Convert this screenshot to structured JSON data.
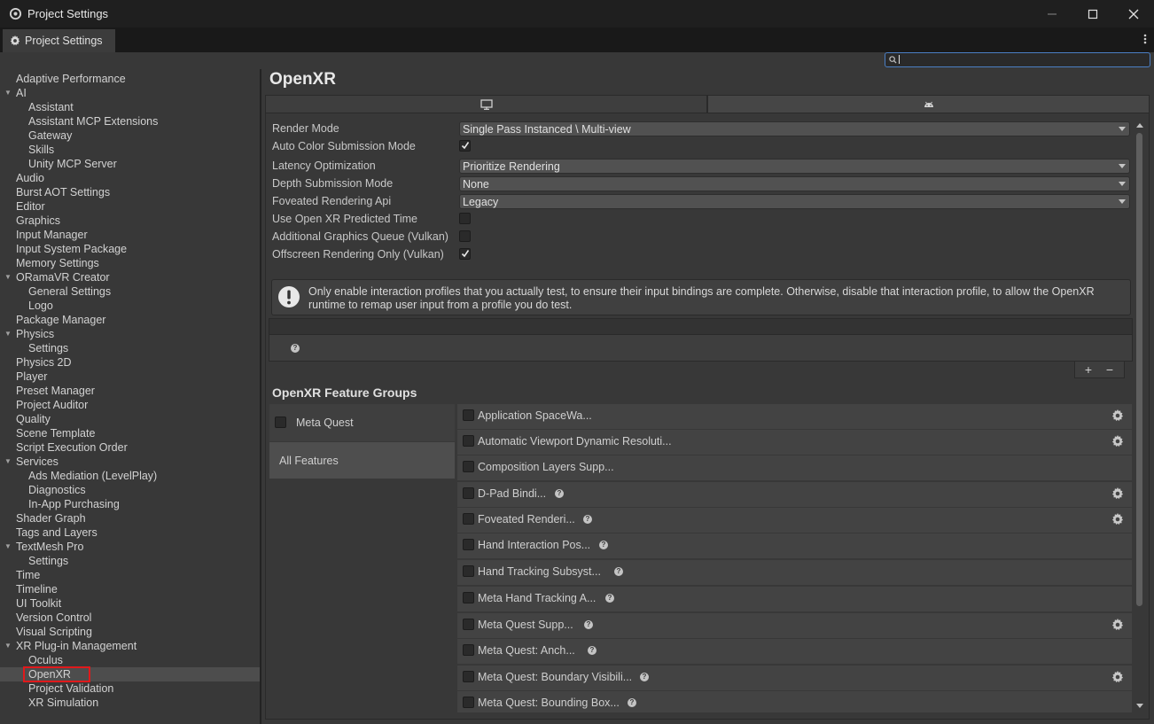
{
  "window": {
    "title": "Project Settings"
  },
  "tab": {
    "label": "Project Settings"
  },
  "search": {
    "placeholder": ""
  },
  "sidebar": {
    "items": [
      {
        "label": "Adaptive Performance",
        "level": 0
      },
      {
        "label": "AI",
        "level": 0,
        "expanded": true
      },
      {
        "label": "Assistant",
        "level": 1
      },
      {
        "label": "Assistant MCP Extensions",
        "level": 1
      },
      {
        "label": "Gateway",
        "level": 1
      },
      {
        "label": "Skills",
        "level": 1
      },
      {
        "label": "Unity MCP Server",
        "level": 1
      },
      {
        "label": "Audio",
        "level": 0
      },
      {
        "label": "Burst AOT Settings",
        "level": 0
      },
      {
        "label": "Editor",
        "level": 0
      },
      {
        "label": "Graphics",
        "level": 0
      },
      {
        "label": "Input Manager",
        "level": 0
      },
      {
        "label": "Input System Package",
        "level": 0
      },
      {
        "label": "Memory Settings",
        "level": 0
      },
      {
        "label": "ORamaVR Creator",
        "level": 0,
        "expanded": true
      },
      {
        "label": "General Settings",
        "level": 1
      },
      {
        "label": "Logo",
        "level": 1
      },
      {
        "label": "Package Manager",
        "level": 0
      },
      {
        "label": "Physics",
        "level": 0,
        "expanded": true
      },
      {
        "label": "Settings",
        "level": 1
      },
      {
        "label": "Physics 2D",
        "level": 0
      },
      {
        "label": "Player",
        "level": 0
      },
      {
        "label": "Preset Manager",
        "level": 0
      },
      {
        "label": "Project Auditor",
        "level": 0
      },
      {
        "label": "Quality",
        "level": 0
      },
      {
        "label": "Scene Template",
        "level": 0
      },
      {
        "label": "Script Execution Order",
        "level": 0
      },
      {
        "label": "Services",
        "level": 0,
        "expanded": true
      },
      {
        "label": "Ads Mediation (LevelPlay)",
        "level": 1
      },
      {
        "label": "Diagnostics",
        "level": 1
      },
      {
        "label": "In-App Purchasing",
        "level": 1
      },
      {
        "label": "Shader Graph",
        "level": 0
      },
      {
        "label": "Tags and Layers",
        "level": 0
      },
      {
        "label": "TextMesh Pro",
        "level": 0,
        "expanded": true
      },
      {
        "label": "Settings",
        "level": 1
      },
      {
        "label": "Time",
        "level": 0
      },
      {
        "label": "Timeline",
        "level": 0
      },
      {
        "label": "UI Toolkit",
        "level": 0
      },
      {
        "label": "Version Control",
        "level": 0
      },
      {
        "label": "Visual Scripting",
        "level": 0
      },
      {
        "label": "XR Plug-in Management",
        "level": 0,
        "expanded": true
      },
      {
        "label": "Oculus",
        "level": 1
      },
      {
        "label": "OpenXR",
        "level": 1,
        "selected": true
      },
      {
        "label": "Project Validation",
        "level": 1
      },
      {
        "label": "XR Simulation",
        "level": 1
      }
    ]
  },
  "main": {
    "title": "OpenXR",
    "platform_tabs": [
      {
        "icon": "monitor-icon",
        "selected": false
      },
      {
        "icon": "android-icon",
        "selected": true
      }
    ],
    "properties": [
      {
        "label": "Render Mode",
        "type": "dropdown",
        "value": "Single Pass Instanced \\ Multi-view"
      },
      {
        "label": "Auto Color Submission Mode",
        "type": "checkbox",
        "checked": true
      },
      {
        "label": "Latency Optimization",
        "type": "dropdown",
        "value": "Prioritize Rendering"
      },
      {
        "label": "Depth Submission Mode",
        "type": "dropdown",
        "value": "None"
      },
      {
        "label": "Foveated Rendering Api",
        "type": "dropdown",
        "value": "Legacy"
      },
      {
        "label": "Use Open XR Predicted Time",
        "type": "checkbox",
        "checked": false
      },
      {
        "label": "Additional Graphics Queue (Vulkan)",
        "type": "checkbox",
        "checked": false
      },
      {
        "label": "Offscreen Rendering Only (Vulkan)",
        "type": "checkbox",
        "checked": true
      }
    ],
    "help_message": "Only enable interaction profiles that you actually test, to ensure their input bindings are complete. Otherwise, disable that interaction profile, to allow the OpenXR runtime to remap user input from a profile you do test.",
    "list_footer": {
      "add": "+",
      "remove": "−"
    },
    "feature_groups_title": "OpenXR Feature Groups",
    "groups": [
      {
        "label": "Meta Quest",
        "checkbox": true,
        "checked": false
      },
      {
        "label": "All Features",
        "selected": true
      }
    ],
    "features": [
      {
        "label": "Application SpaceWa...",
        "help": false,
        "gear": true
      },
      {
        "label": "Automatic Viewport Dynamic Resoluti...",
        "help": false,
        "gear": true
      },
      {
        "label": "Composition Layers Supp...",
        "help": false,
        "gear": false
      },
      {
        "label": "D-Pad Bindi...",
        "help": true,
        "gear": true
      },
      {
        "label": "Foveated Renderi...",
        "help": true,
        "gear": true
      },
      {
        "label": "Hand Interaction Pos...",
        "help": true,
        "gear": false
      },
      {
        "label": "Hand Tracking Subsyst...",
        "help": true,
        "gear": false
      },
      {
        "label": "Meta Hand Tracking A...",
        "help": true,
        "gear": false
      },
      {
        "label": "Meta Quest Supp...",
        "help": true,
        "gear": true
      },
      {
        "label": "Meta Quest: Anch...",
        "help": true,
        "gear": false
      },
      {
        "label": "Meta Quest: Boundary Visibili...",
        "help": true,
        "gear": true
      },
      {
        "label": "Meta Quest: Bounding Box...",
        "help": true,
        "gear": false
      }
    ]
  },
  "colors": {
    "background": "#383838",
    "titlebar": "#1f1f1f",
    "selection": "#4d4d4d",
    "highlight_outline": "#e0191b",
    "search_focus": "#4b7fc4"
  }
}
